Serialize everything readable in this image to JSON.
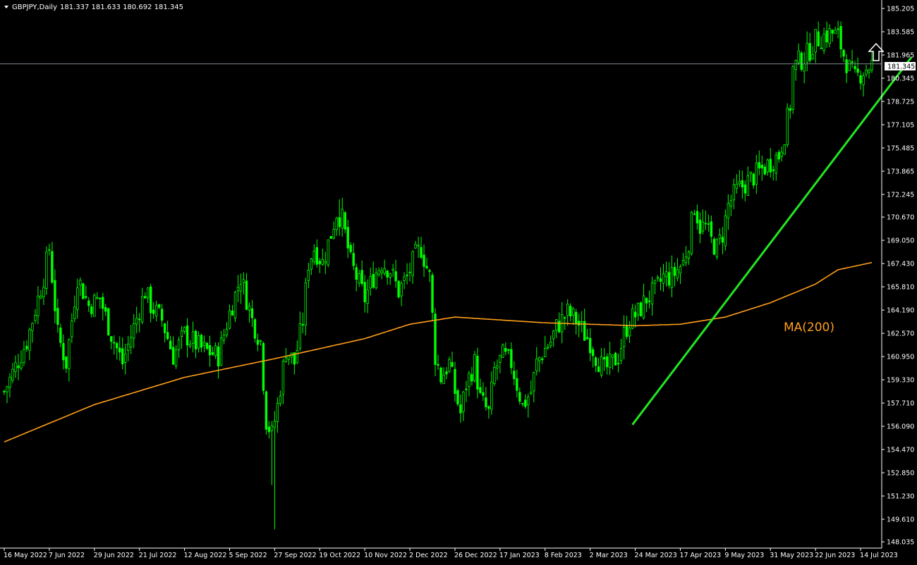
{
  "header": {
    "symbol_timeframe": "GBPJPY,Daily",
    "ohlc": "181.337 181.633 180.692 181.345"
  },
  "colors": {
    "background": "#000000",
    "candle": "#00ff00",
    "ma": "#ff9f1a",
    "trendline": "#22e622",
    "axis": "#ffffff",
    "price_line": "#7f8a93"
  },
  "chart_data": {
    "type": "candlestick",
    "title": "GBPJPY,Daily",
    "y_axis": {
      "ylim": [
        147.6,
        185.6
      ],
      "ticks": [
        "185.205",
        "183.585",
        "181.965",
        "180.345",
        "178.725",
        "177.105",
        "175.485",
        "173.865",
        "172.245",
        "170.670",
        "169.050",
        "167.430",
        "165.810",
        "164.190",
        "162.570",
        "160.950",
        "159.330",
        "157.710",
        "156.090",
        "154.470",
        "152.850",
        "151.230",
        "149.610",
        "148.035"
      ]
    },
    "x_axis": {
      "ticks": [
        "16 May 2022",
        "7 Jun 2022",
        "29 Jun 2022",
        "21 Jul 2022",
        "12 Aug 2022",
        "5 Sep 2022",
        "27 Sep 2022",
        "19 Oct 2022",
        "10 Nov 2022",
        "2 Dec 2022",
        "26 Dec 2022",
        "17 Jan 2023",
        "8 Feb 2023",
        "2 Mar 2023",
        "24 Mar 2023",
        "17 Apr 2023",
        "9 May 2023",
        "31 May 2023",
        "22 Jun 2023",
        "14 Jul 2023"
      ],
      "tick_index": [
        0,
        16,
        32,
        48,
        64,
        80,
        96,
        112,
        128,
        144,
        160,
        176,
        192,
        208,
        224,
        240,
        256,
        272,
        288,
        304
      ],
      "bars": 312
    },
    "price_path": [
      [
        0,
        158.5
      ],
      [
        8,
        162.0
      ],
      [
        14,
        166.5
      ],
      [
        16,
        168.5
      ],
      [
        19,
        162.5
      ],
      [
        22,
        160.5
      ],
      [
        26,
        166.5
      ],
      [
        30,
        164.5
      ],
      [
        34,
        165.0
      ],
      [
        38,
        162.5
      ],
      [
        42,
        160.5
      ],
      [
        46,
        163.0
      ],
      [
        50,
        165.5
      ],
      [
        52,
        164.5
      ],
      [
        56,
        163.5
      ],
      [
        60,
        161.0
      ],
      [
        64,
        162.5
      ],
      [
        70,
        161.5
      ],
      [
        76,
        161.0
      ],
      [
        80,
        164.0
      ],
      [
        84,
        166.5
      ],
      [
        88,
        163.5
      ],
      [
        91,
        162.0
      ],
      [
        93,
        156.5
      ],
      [
        95,
        155.5
      ],
      [
        97,
        157.5
      ],
      [
        100,
        161.5
      ],
      [
        103,
        160.5
      ],
      [
        106,
        163.5
      ],
      [
        108,
        167.5
      ],
      [
        110,
        168.5
      ],
      [
        113,
        167.5
      ],
      [
        116,
        169.5
      ],
      [
        118,
        171.0
      ],
      [
        120,
        170.5
      ],
      [
        123,
        167.5
      ],
      [
        126,
        166.0
      ],
      [
        128,
        165.0
      ],
      [
        131,
        166.5
      ],
      [
        134,
        167.5
      ],
      [
        137,
        167.0
      ],
      [
        140,
        165.5
      ],
      [
        143,
        166.5
      ],
      [
        146,
        168.0
      ],
      [
        148,
        168.5
      ],
      [
        151,
        166.5
      ],
      [
        153,
        161.0
      ],
      [
        155,
        159.5
      ],
      [
        158,
        160.5
      ],
      [
        160,
        158.5
      ],
      [
        162,
        157.0
      ],
      [
        164,
        159.0
      ],
      [
        167,
        160.5
      ],
      [
        169,
        158.0
      ],
      [
        172,
        157.0
      ],
      [
        174,
        160.0
      ],
      [
        177,
        161.0
      ],
      [
        180,
        160.5
      ],
      [
        182,
        159.0
      ],
      [
        184,
        157.5
      ],
      [
        187,
        158.5
      ],
      [
        189,
        160.5
      ],
      [
        192,
        161.5
      ],
      [
        194,
        162.0
      ],
      [
        196,
        163.0
      ],
      [
        198,
        163.5
      ],
      [
        200,
        164.0
      ],
      [
        203,
        163.5
      ],
      [
        206,
        162.5
      ],
      [
        208,
        162.0
      ],
      [
        210,
        161.0
      ],
      [
        213,
        160.0
      ],
      [
        216,
        160.5
      ],
      [
        218,
        161.0
      ],
      [
        220,
        162.5
      ],
      [
        222,
        163.5
      ],
      [
        225,
        164.0
      ],
      [
        228,
        165.0
      ],
      [
        231,
        165.5
      ],
      [
        234,
        166.5
      ],
      [
        237,
        166.5
      ],
      [
        239,
        167.0
      ],
      [
        241,
        167.5
      ],
      [
        243,
        169.0
      ],
      [
        245,
        171.5
      ],
      [
        247,
        170.0
      ],
      [
        249,
        170.0
      ],
      [
        251,
        169.0
      ],
      [
        253,
        168.5
      ],
      [
        255,
        169.5
      ],
      [
        257,
        171.5
      ],
      [
        260,
        172.5
      ],
      [
        263,
        173.0
      ],
      [
        266,
        173.5
      ],
      [
        269,
        174.0
      ],
      [
        272,
        174.5
      ],
      [
        275,
        175.0
      ],
      [
        277,
        176.5
      ],
      [
        279,
        178.5
      ],
      [
        280,
        181.0
      ],
      [
        282,
        181.5
      ],
      [
        285,
        182.0
      ],
      [
        288,
        183.0
      ],
      [
        291,
        183.3
      ],
      [
        294,
        183.5
      ],
      [
        296,
        183.2
      ],
      [
        298,
        182.0
      ],
      [
        300,
        181.0
      ],
      [
        302,
        180.3
      ],
      [
        305,
        180.9
      ],
      [
        308,
        181.345
      ]
    ],
    "ma200": {
      "name": "MA(200)",
      "values": [
        [
          0,
          155.0
        ],
        [
          32,
          157.6
        ],
        [
          64,
          159.5
        ],
        [
          96,
          160.8
        ],
        [
          128,
          162.2
        ],
        [
          144,
          163.2
        ],
        [
          160,
          163.7
        ],
        [
          176,
          163.5
        ],
        [
          192,
          163.3
        ],
        [
          208,
          163.2
        ],
        [
          224,
          163.1
        ],
        [
          240,
          163.2
        ],
        [
          256,
          163.7
        ],
        [
          272,
          164.7
        ],
        [
          288,
          166.0
        ],
        [
          296,
          167.0
        ],
        [
          308,
          167.5
        ]
      ]
    },
    "trendline": {
      "from": [
        223,
        156.2
      ],
      "to": [
        322,
        181.8
      ]
    },
    "current_price": "181.345"
  }
}
